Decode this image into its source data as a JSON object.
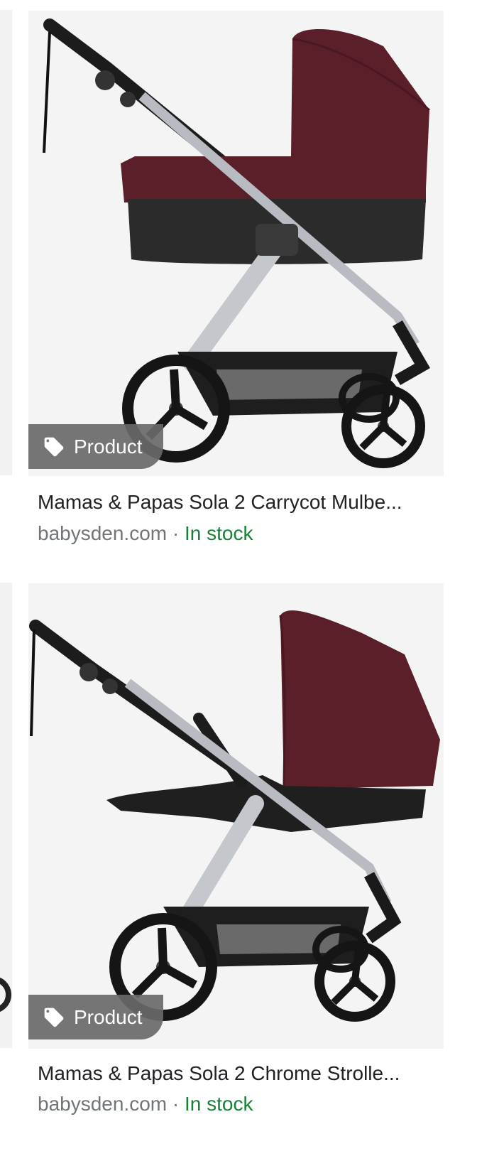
{
  "results": [
    {
      "title": "Mamas & Papas Sola 2 Carrycot Mulbe...",
      "source": "babysden.com",
      "separator": " · ",
      "stock": "In stock",
      "badge": "Product",
      "image_alt": "Mulberry carrycot on chrome stroller chassis"
    },
    {
      "title": "Mamas & Papas Sola 2 Chrome Strolle...",
      "source": "babysden.com",
      "separator": " · ",
      "stock": "In stock",
      "badge": "Product",
      "image_alt": "Chrome stroller with mulberry hood"
    }
  ],
  "colors": {
    "mulberry": "#5b1f2a",
    "stock_green": "#188038",
    "badge_bg": "#696969",
    "chrome": "#b8bcc2"
  },
  "icons": {
    "badge_icon": "tag-icon"
  }
}
